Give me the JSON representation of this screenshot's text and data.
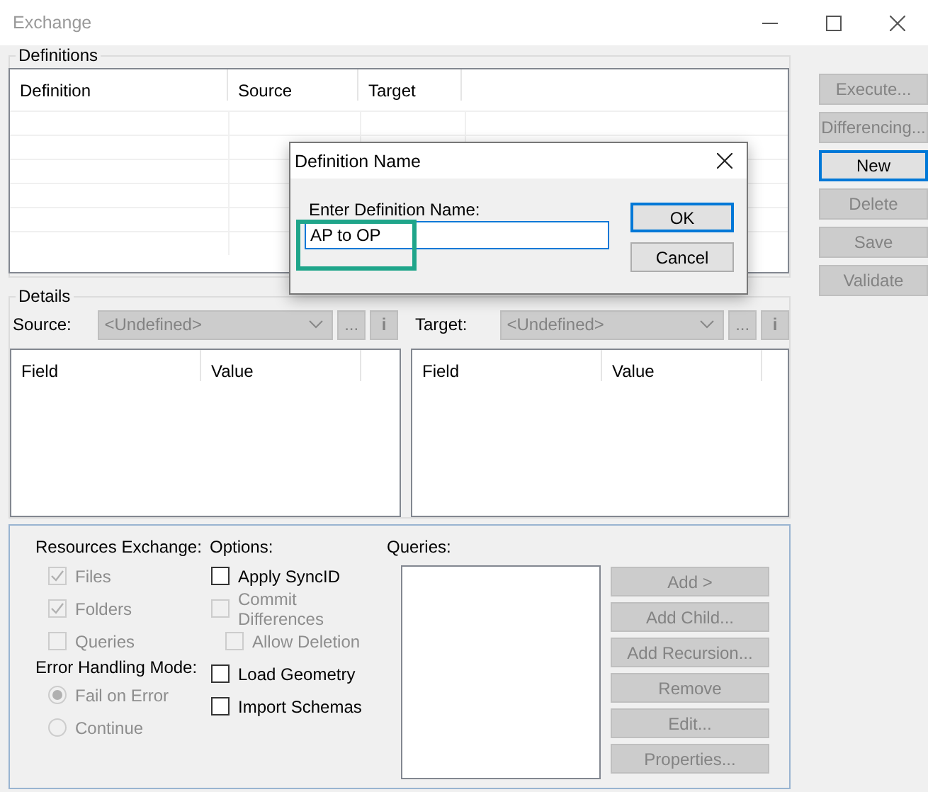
{
  "window": {
    "title": "Exchange"
  },
  "definitions": {
    "title": "Definitions",
    "columns": [
      "Definition",
      "Source",
      "Target"
    ]
  },
  "side_buttons": [
    {
      "label": "Execute...",
      "disabled": true,
      "focused": false
    },
    {
      "label": "Differencing...",
      "disabled": true,
      "focused": false
    },
    {
      "label": "New",
      "disabled": false,
      "focused": true
    },
    {
      "label": "Delete",
      "disabled": true,
      "focused": false
    },
    {
      "label": "Save",
      "disabled": true,
      "focused": false
    },
    {
      "label": "Validate",
      "disabled": true,
      "focused": false
    }
  ],
  "details": {
    "title": "Details",
    "source": {
      "label": "Source:",
      "value": "<Undefined>",
      "disabled": true,
      "browse": "...",
      "info": "i"
    },
    "target": {
      "label": "Target:",
      "value": "<Undefined>",
      "disabled": true,
      "browse": "...",
      "info": "i"
    },
    "source_columns": [
      "Field",
      "Value"
    ],
    "target_columns": [
      "Field",
      "Value"
    ]
  },
  "resources": {
    "label": "Resources Exchange:",
    "items": [
      {
        "label": "Files",
        "checked": true,
        "disabled": true
      },
      {
        "label": "Folders",
        "checked": true,
        "disabled": true
      },
      {
        "label": "Queries",
        "checked": false,
        "disabled": true
      }
    ]
  },
  "error_mode": {
    "label": "Error Handling Mode:",
    "options": [
      {
        "label": "Fail on Error",
        "selected": true,
        "disabled": true
      },
      {
        "label": "Continue",
        "selected": false,
        "disabled": true
      }
    ]
  },
  "options": {
    "label": "Options:",
    "items": [
      {
        "label": "Apply SyncID",
        "checked": false,
        "disabled": false
      },
      {
        "label": "Commit Differences",
        "checked": false,
        "disabled": true,
        "children": [
          {
            "label": "Allow Deletion",
            "checked": false,
            "disabled": true
          }
        ]
      },
      {
        "label": "Load Geometry",
        "checked": false,
        "disabled": false
      },
      {
        "label": "Import Schemas",
        "checked": false,
        "disabled": false
      }
    ]
  },
  "queries": {
    "label": "Queries:",
    "buttons": [
      {
        "label": "Add  >",
        "disabled": true
      },
      {
        "label": "Add Child...",
        "disabled": true
      },
      {
        "label": "Add Recursion...",
        "disabled": true
      },
      {
        "label": "Remove",
        "disabled": true
      },
      {
        "label": "Edit...",
        "disabled": true
      },
      {
        "label": "Properties...",
        "disabled": true
      }
    ]
  },
  "dialog": {
    "title": "Definition Name",
    "prompt": "Enter Definition Name:",
    "value": "AP to OP",
    "highlighted": true,
    "buttons": [
      {
        "label": "OK",
        "focused": true
      },
      {
        "label": "Cancel",
        "focused": false
      }
    ]
  }
}
